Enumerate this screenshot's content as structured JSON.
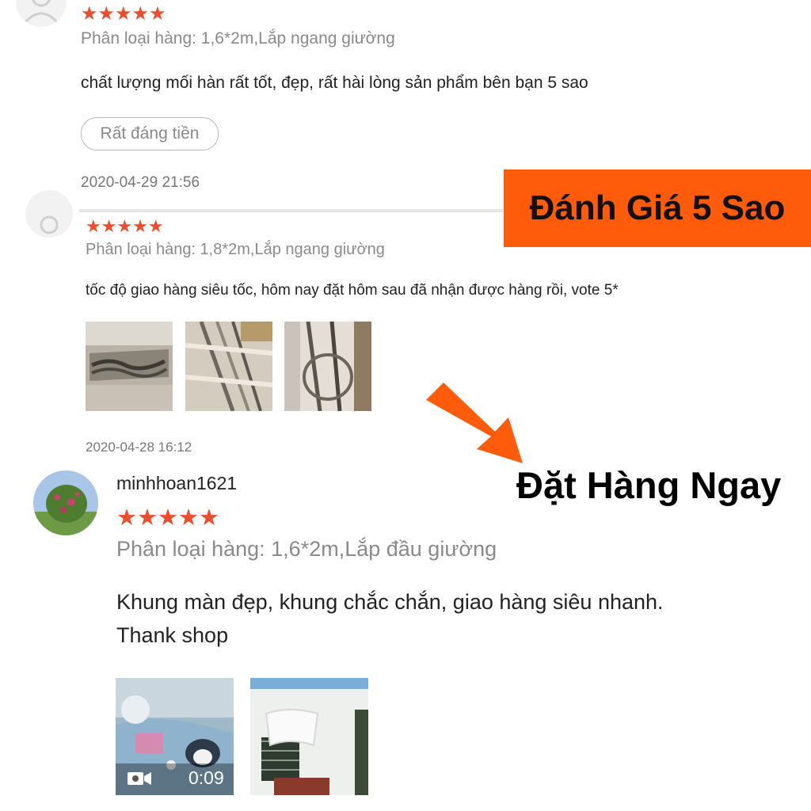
{
  "banners": {
    "rating_banner": "Đánh Giá 5 Sao",
    "order_now": "Đặt Hàng Ngay",
    "colors": {
      "banner_bg": "#fe5b0a",
      "star": "#ee4d2d"
    }
  },
  "reviews": [
    {
      "stars": "★★★★★",
      "rating": 5,
      "variant": "Phân loại hàng: 1,6*2m,Lắp ngang giường",
      "comment": "chất lượng mối hàn rất tốt, đẹp, rất hài lòng sản phẩm bên bạn 5 sao",
      "tag": "Rất đáng tiền",
      "date": "2020-04-29 21:56"
    },
    {
      "stars": "★★★★★",
      "rating": 5,
      "variant": "Phân loại hàng: 1,8*2m,Lắp ngang giường",
      "comment": "tốc độ giao hàng siêu tốc, hôm nay đặt hôm sau đã nhận được hàng rồi, vote 5*",
      "date": "2020-04-28 16:12"
    },
    {
      "username": "minhhoan1621",
      "stars": "★★★★★",
      "rating": 5,
      "variant": "Phân loại hàng: 1,6*2m,Lắp đầu giường",
      "comment_line1": "Khung màn đẹp, khung chắc chắn, giao hàng siêu nhanh.",
      "comment_line2": "Thank shop",
      "video_duration": "0:09",
      "video_icon": "video-camera-icon"
    }
  ]
}
